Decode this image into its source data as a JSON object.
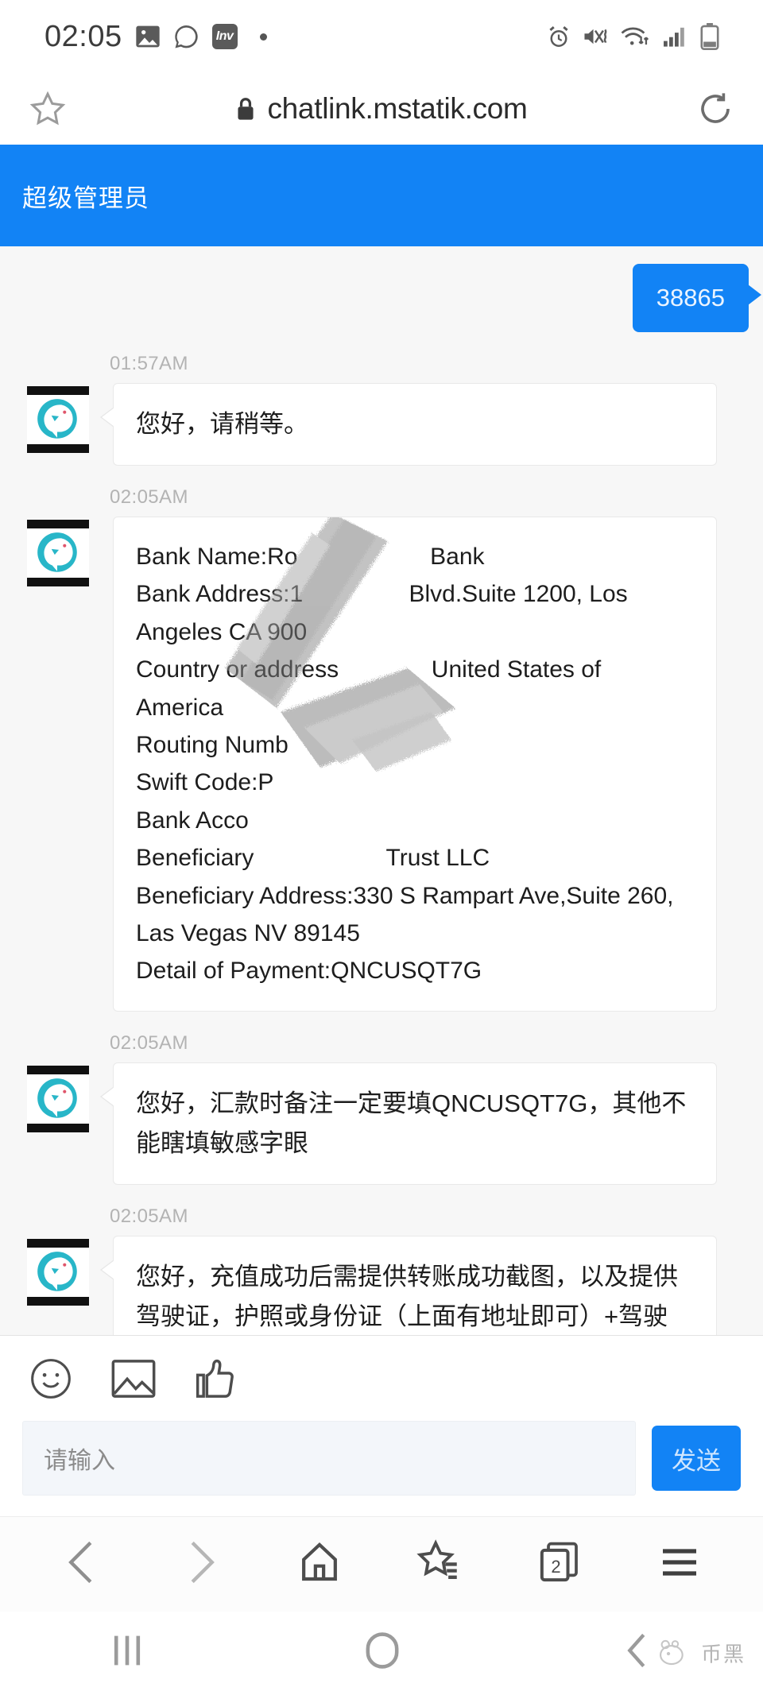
{
  "statusbar": {
    "time": "02:05",
    "icons_left": [
      "photo-icon",
      "whatsapp-icon",
      "inv-app-icon",
      "dot-indicator"
    ],
    "inv_label": "Inv",
    "icons_right": [
      "alarm-icon",
      "mute-vibrate-icon",
      "wifi-icon",
      "signal-icon",
      "battery-icon"
    ]
  },
  "browser": {
    "bookmark_icon": "star-icon",
    "lock_icon": "lock-icon",
    "url": "chatlink.mstatik.com",
    "reload_icon": "reload-icon",
    "nav": {
      "back": "back-chevron-icon",
      "forward": "forward-chevron-icon",
      "home": "home-icon",
      "bookmarks": "star-list-icon",
      "tabs_icon": "tabs-icon",
      "tabs_count": "2",
      "menu": "hamburger-menu-icon"
    }
  },
  "app": {
    "header_title": "超级管理员",
    "header_color": "#1283f5"
  },
  "chat": {
    "messages": [
      {
        "id": "msg-out-1",
        "direction": "outgoing",
        "text": "38865"
      },
      {
        "id": "msg-in-1",
        "direction": "incoming",
        "time": "01:57AM",
        "text": "您好，请稍等。"
      },
      {
        "id": "msg-in-2",
        "direction": "incoming",
        "time": "02:05AM",
        "redacted": true,
        "lines": [
          "Bank Name:Ro                    Bank",
          "Bank Address:1                Blvd.Suite 1200, Los",
          "Angeles CA 900",
          "Country or address              United States of",
          "America",
          "Routing Numb",
          "Swift Code:P",
          "Bank Acco",
          "Beneficiary                    Trust LLC",
          "Beneficiary Address:330 S Rampart Ave,Suite 260,",
          "Las Vegas NV 89145",
          "Detail of Payment:QNCUSQT7G"
        ]
      },
      {
        "id": "msg-in-3",
        "direction": "incoming",
        "time": "02:05AM",
        "text": "您好，汇款时备注一定要填QNCUSQT7G，其他不能瞎填敏感字眼"
      },
      {
        "id": "msg-in-4",
        "direction": "incoming",
        "time": "02:05AM",
        "text": "您好，充值成功后需提供转账成功截图，以及提供驾驶证，护照或身份证（上面有地址即可）+驾驶证，护照或身份证照片。（需提供两证）"
      }
    ]
  },
  "composer": {
    "emoji_icon": "smiley-icon",
    "image_icon": "image-icon",
    "thumbsup_icon": "thumbs-up-icon",
    "placeholder": "请输入",
    "send_label": "发送"
  },
  "system_nav": {
    "recents": "recents-icon",
    "home": "home-circle-icon",
    "back": "back-icon"
  },
  "watermark": {
    "text": "币黑"
  }
}
